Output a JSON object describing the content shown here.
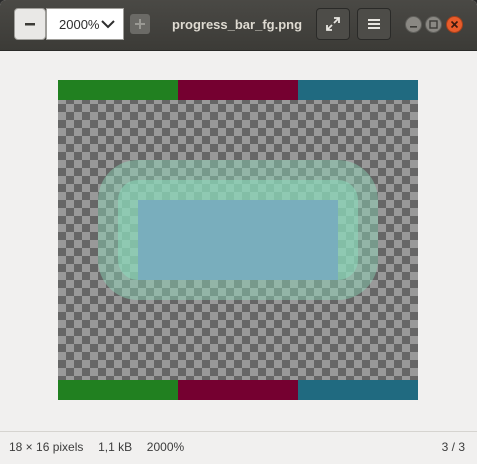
{
  "window": {
    "title": "progress_bar_fg.png"
  },
  "toolbar": {
    "zoom_value": "2000%",
    "zoom_out_icon": "minus-icon",
    "zoom_in_icon": "plus-icon",
    "zoom_dropdown_icon": "chevron-down-icon",
    "fullscreen_icon": "fullscreen-icon",
    "menu_icon": "hamburger-menu-icon"
  },
  "window_controls": {
    "minimize_icon": "minimize-icon",
    "maximize_icon": "maximize-icon",
    "close_icon": "close-icon"
  },
  "image": {
    "stripe_colors": [
      "#218020",
      "#750030",
      "#206a80"
    ],
    "inner_color": "#79aebd",
    "glow_color": "#8cd7b9"
  },
  "status": {
    "dimensions": "18 × 16 pixels",
    "size": "1,1 kB",
    "zoom": "2000%",
    "position": "3 / 3"
  }
}
